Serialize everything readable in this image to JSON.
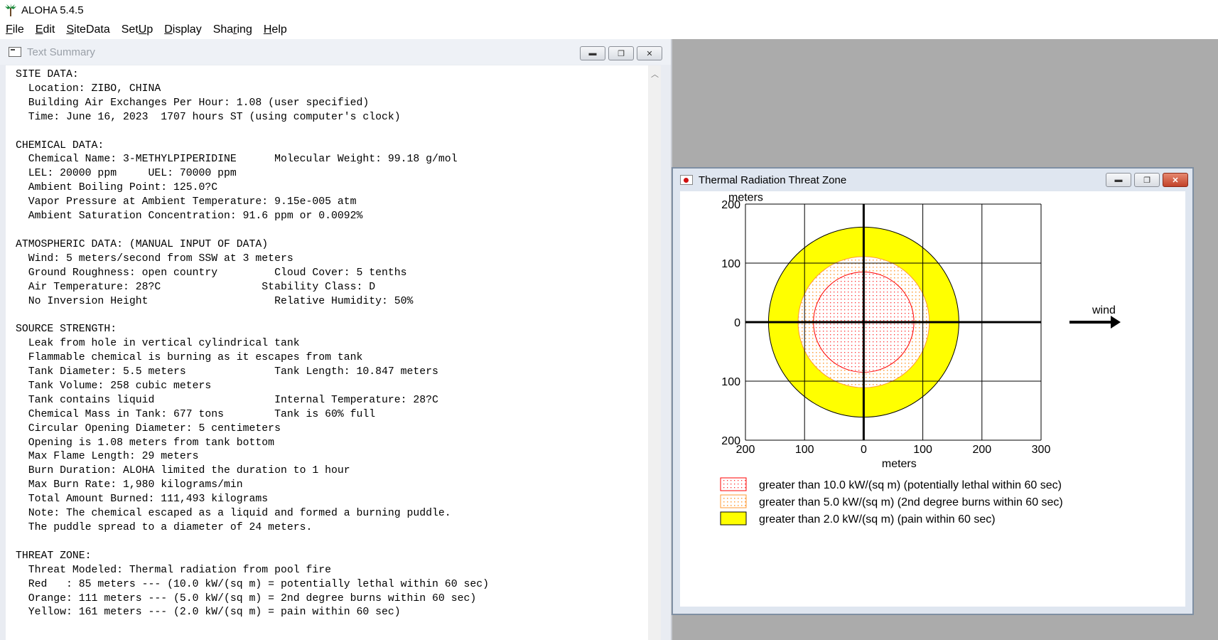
{
  "app": {
    "title": "ALOHA 5.4.5"
  },
  "menu": [
    {
      "pre": "",
      "u": "F",
      "post": "ile"
    },
    {
      "pre": "",
      "u": "E",
      "post": "dit"
    },
    {
      "pre": "",
      "u": "S",
      "post": "iteData"
    },
    {
      "pre": "Set",
      "u": "U",
      "post": "p"
    },
    {
      "pre": "",
      "u": "D",
      "post": "isplay"
    },
    {
      "pre": "Sha",
      "u": "r",
      "post": "ing"
    },
    {
      "pre": "",
      "u": "H",
      "post": "elp"
    }
  ],
  "text_summary": {
    "title": "Text Summary",
    "lines": [
      "SITE DATA:",
      "  Location: ZIBO, CHINA",
      "  Building Air Exchanges Per Hour: 1.08 (user specified)",
      "  Time: June 16, 2023  1707 hours ST (using computer's clock)",
      "",
      "CHEMICAL DATA:",
      "  Chemical Name: 3-METHYLPIPERIDINE      Molecular Weight: 99.18 g/mol",
      "  LEL: 20000 ppm     UEL: 70000 ppm",
      "  Ambient Boiling Point: 125.0?C",
      "  Vapor Pressure at Ambient Temperature: 9.15e-005 atm",
      "  Ambient Saturation Concentration: 91.6 ppm or 0.0092%",
      "",
      "ATMOSPHERIC DATA: (MANUAL INPUT OF DATA)",
      "  Wind: 5 meters/second from SSW at 3 meters",
      "  Ground Roughness: open country         Cloud Cover: 5 tenths",
      "  Air Temperature: 28?C                Stability Class: D",
      "  No Inversion Height                    Relative Humidity: 50%",
      "",
      "SOURCE STRENGTH:",
      "  Leak from hole in vertical cylindrical tank",
      "  Flammable chemical is burning as it escapes from tank",
      "  Tank Diameter: 5.5 meters              Tank Length: 10.847 meters",
      "  Tank Volume: 258 cubic meters",
      "  Tank contains liquid                   Internal Temperature: 28?C",
      "  Chemical Mass in Tank: 677 tons        Tank is 60% full",
      "  Circular Opening Diameter: 5 centimeters",
      "  Opening is 1.08 meters from tank bottom",
      "  Max Flame Length: 29 meters",
      "  Burn Duration: ALOHA limited the duration to 1 hour",
      "  Max Burn Rate: 1,980 kilograms/min",
      "  Total Amount Burned: 111,493 kilograms",
      "  Note: The chemical escaped as a liquid and formed a burning puddle.",
      "  The puddle spread to a diameter of 24 meters.",
      "",
      "THREAT ZONE:",
      "  Threat Modeled: Thermal radiation from pool fire",
      "  Red   : 85 meters --- (10.0 kW/(sq m) = potentially lethal within 60 sec)",
      "  Orange: 111 meters --- (5.0 kW/(sq m) = 2nd degree burns within 60 sec)",
      "  Yellow: 161 meters --- (2.0 kW/(sq m) = pain within 60 sec)"
    ]
  },
  "thermal_window": {
    "title": "Thermal Radiation Threat Zone"
  },
  "chart_data": {
    "type": "threat-zone-plot",
    "ylabel": "meters",
    "xlabel": "meters",
    "x_ticks": [
      "200",
      "100",
      "0",
      "100",
      "200",
      "300"
    ],
    "x_tick_values": [
      -200,
      -100,
      0,
      100,
      200,
      300
    ],
    "y_ticks": [
      "200",
      "100",
      "0",
      "100",
      "200"
    ],
    "y_tick_values": [
      200,
      100,
      0,
      -100,
      -200
    ],
    "xlim": [
      -200,
      300
    ],
    "ylim": [
      -200,
      200
    ],
    "wind_label": "wind",
    "zones": [
      {
        "name": "yellow",
        "radius": 161,
        "fill": "#ffff00",
        "stroke": "#000000",
        "pattern": "solid"
      },
      {
        "name": "orange",
        "radius": 111,
        "fill": "#ffd9a8",
        "stroke": "#ff9933",
        "pattern": "dots-orange"
      },
      {
        "name": "red",
        "radius": 85,
        "fill": "#ffe6e6",
        "stroke": "#ff0000",
        "pattern": "dots-red"
      }
    ],
    "legend": [
      {
        "label": "greater than 10.0 kW/(sq m) (potentially lethal within 60 sec)",
        "pattern": "dots-red"
      },
      {
        "label": "greater than 5.0 kW/(sq m) (2nd degree burns within 60 sec)",
        "pattern": "dots-orange"
      },
      {
        "label": "greater than 2.0 kW/(sq m) (pain within 60 sec)",
        "pattern": "solid"
      }
    ]
  }
}
